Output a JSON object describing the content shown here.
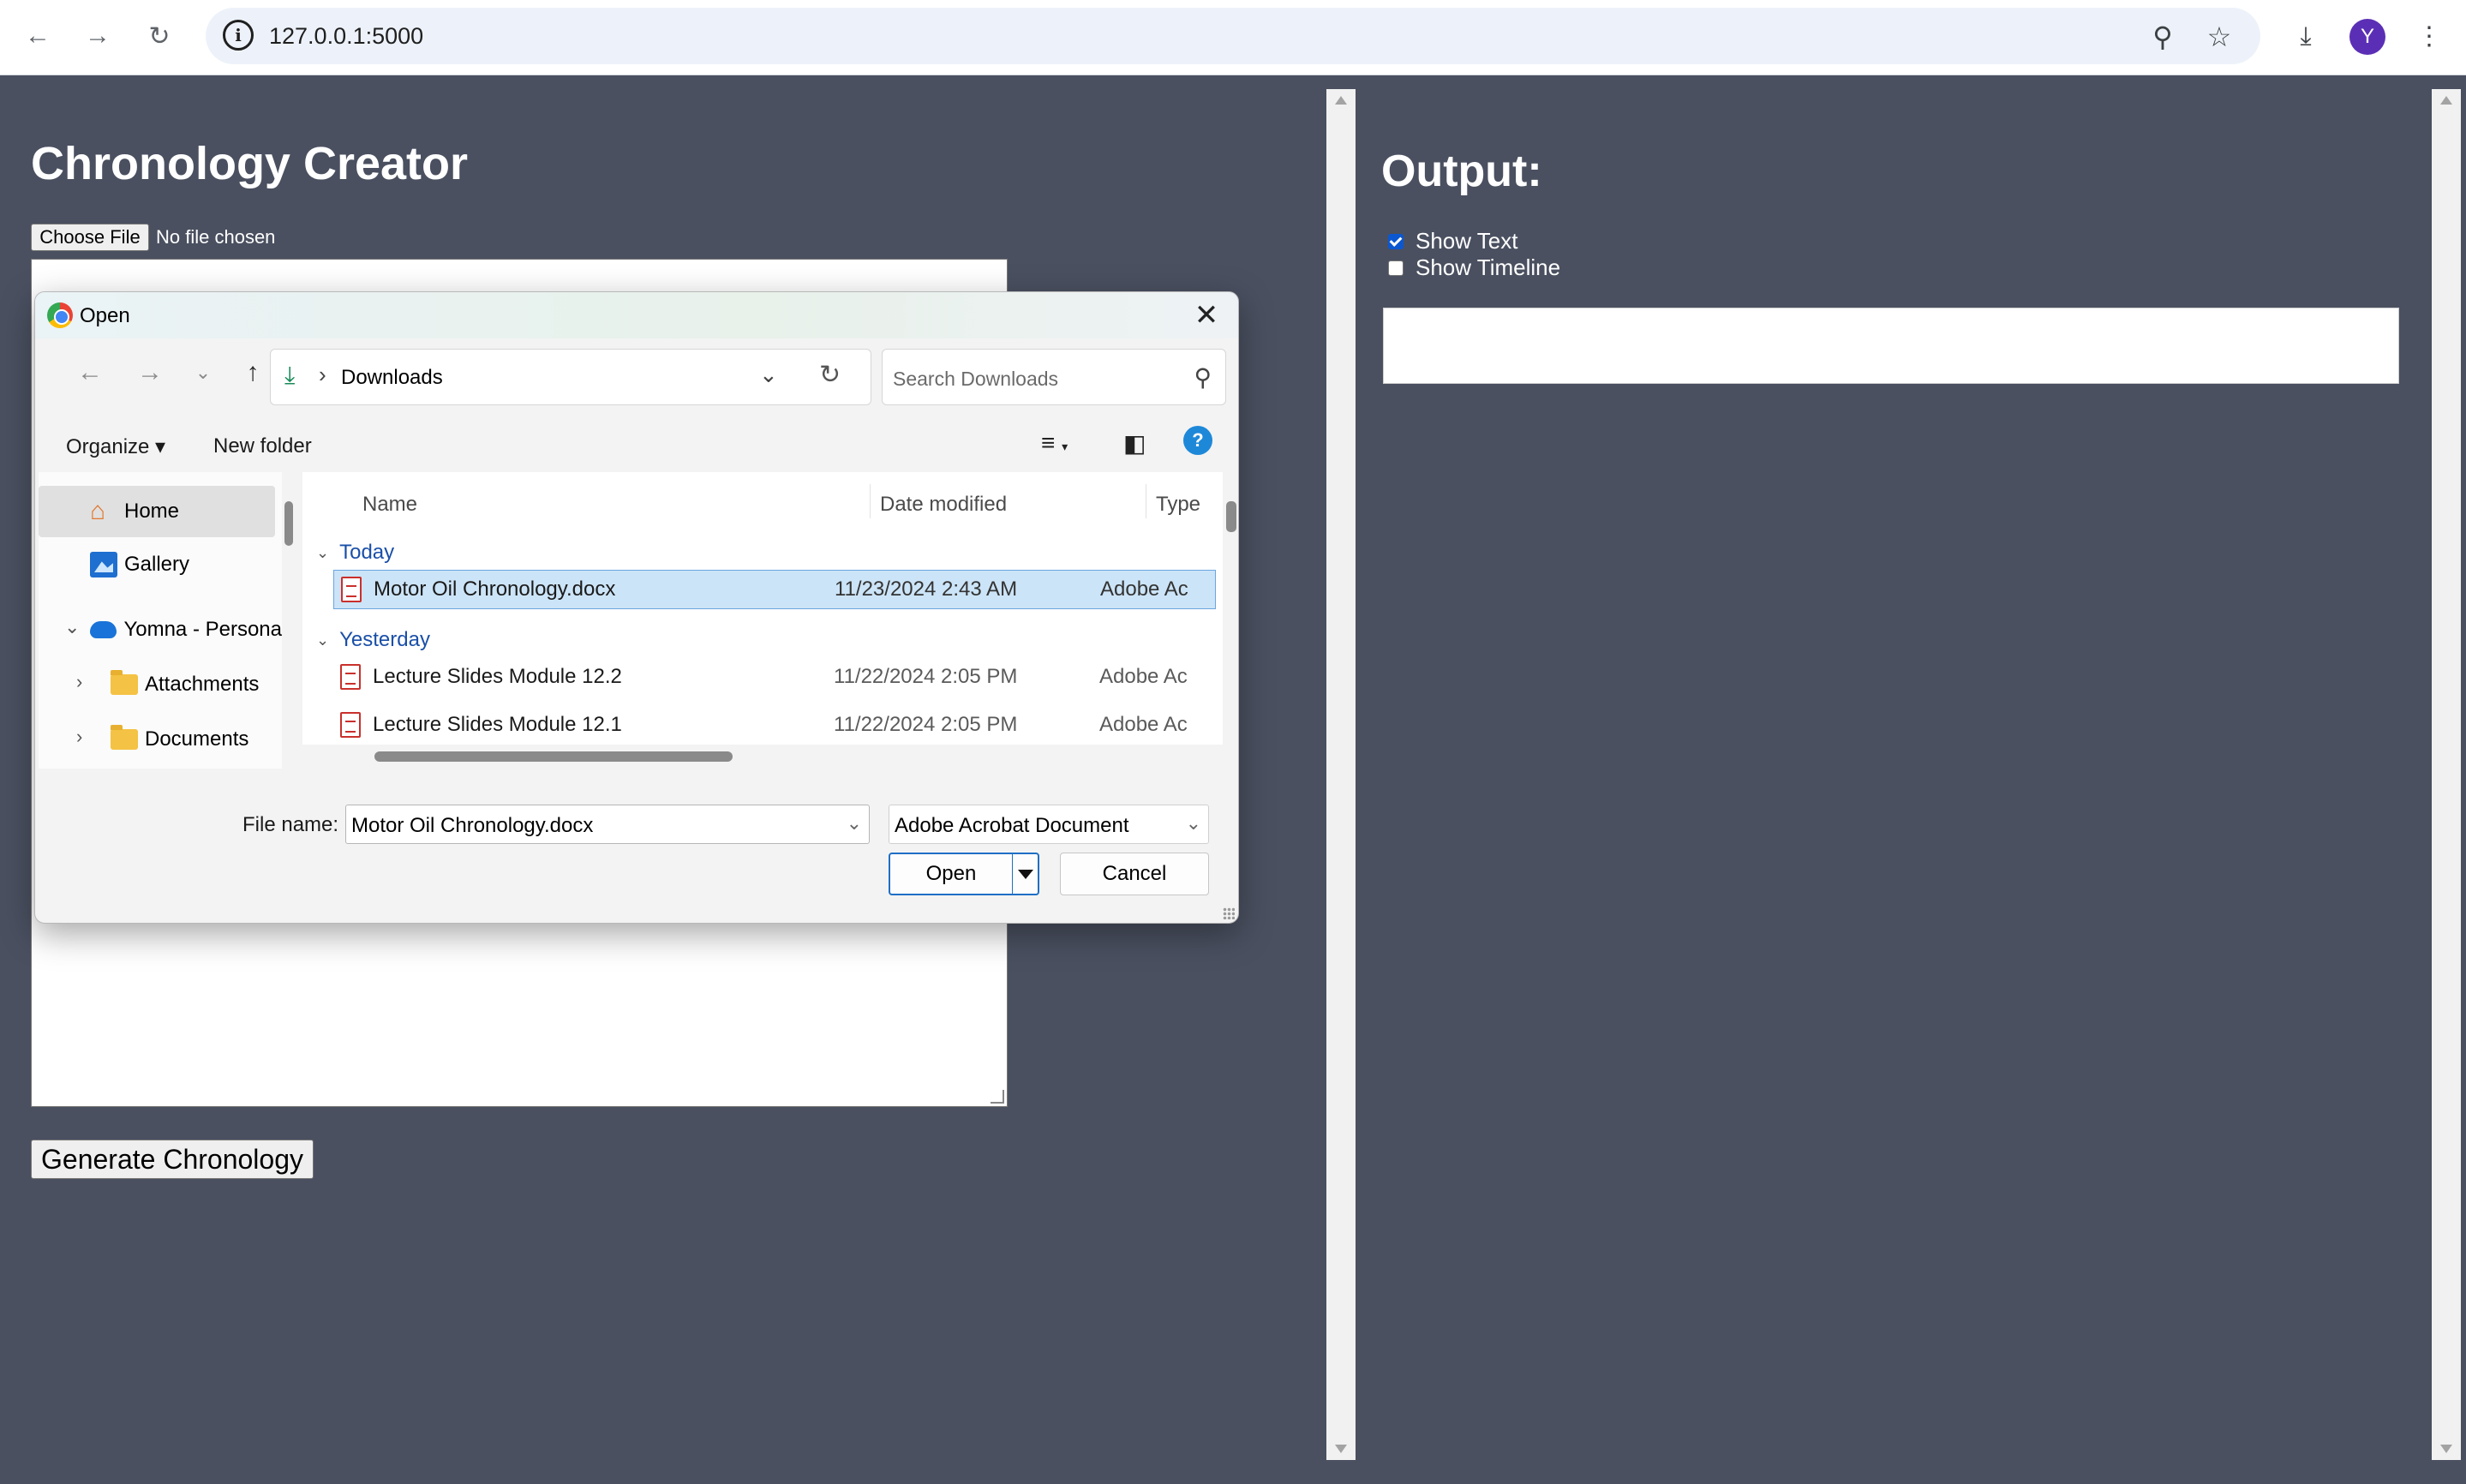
{
  "browser": {
    "url": "127.0.0.1:5000",
    "avatar_letter": "Y"
  },
  "page": {
    "title": "Chronology Creator",
    "choose_file_label": "Choose File",
    "no_file_text": "No file chosen",
    "generate_button": "Generate Chronology"
  },
  "output": {
    "title": "Output:",
    "show_text_label": "Show Text",
    "show_text_checked": true,
    "show_timeline_label": "Show Timeline",
    "show_timeline_checked": false
  },
  "dialog": {
    "title": "Open",
    "path": "Downloads",
    "search_placeholder": "Search Downloads",
    "organize_label": "Organize",
    "new_folder_label": "New folder",
    "nav_items": [
      {
        "label": "Home",
        "icon": "home-icon"
      },
      {
        "label": "Gallery",
        "icon": "gallery-icon"
      },
      {
        "label": "Yomna - Persona",
        "icon": "onedrive-icon"
      },
      {
        "label": "Attachments",
        "icon": "folder-icon"
      },
      {
        "label": "Documents",
        "icon": "folder-icon"
      }
    ],
    "columns": [
      "Name",
      "Date modified",
      "Type"
    ],
    "groups": [
      {
        "label": "Today",
        "files": [
          {
            "name": "Motor Oil Chronology.docx",
            "date": "11/23/2024 2:43 AM",
            "type": "Adobe Ac"
          }
        ]
      },
      {
        "label": "Yesterday",
        "files": [
          {
            "name": "Lecture Slides Module 12.2",
            "date": "11/22/2024 2:05 PM",
            "type": "Adobe Ac"
          },
          {
            "name": "Lecture Slides Module 12.1",
            "date": "11/22/2024 2:05 PM",
            "type": "Adobe Ac"
          }
        ]
      }
    ],
    "file_name_label": "File name:",
    "file_name_value": "Motor Oil Chronology.docx",
    "file_type_value": "Adobe Acrobat Document",
    "open_button": "Open",
    "cancel_button": "Cancel"
  },
  "colors": {
    "page_bg": "#4a5060",
    "accent": "#0b57d0",
    "selection": "#cce4f7"
  }
}
